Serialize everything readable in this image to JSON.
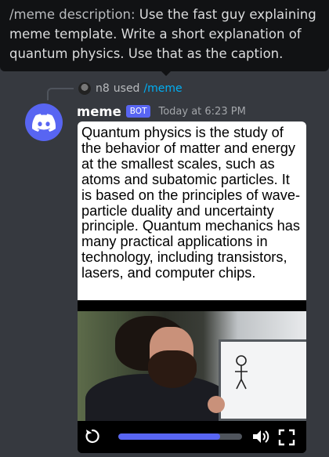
{
  "tooltip": {
    "command": "/meme description:",
    "text": " Use the fast guy explaining meme template. Write a short explanation of quantum physics. Use that as the caption."
  },
  "reply": {
    "user": "n8",
    "used": "used",
    "command": "/meme"
  },
  "message": {
    "author": "meme",
    "bot_tag": "BOT",
    "timestamp": "Today at 6:23 PM",
    "caption": "Quantum physics is the study of the behavior of matter and energy at the smallest scales, such as atoms and subatomic particles. It is based on the principles of wave-particle duality and uncertainty principle. Quantum mechanics has many practical applications in technology, including transistors, lasers, and computer chips."
  },
  "video": {
    "progress": 0.82
  },
  "colors": {
    "background": "#36393f",
    "brand": "#5865f2",
    "link": "#00aff4",
    "tooltip": "#111214"
  }
}
